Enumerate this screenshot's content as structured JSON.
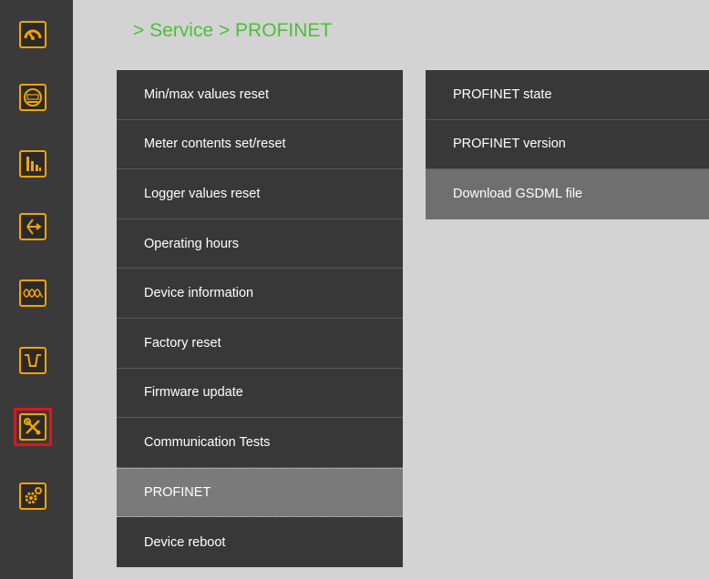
{
  "breadcrumb": "> Service > PROFINET",
  "sidebar": {
    "items": [
      {
        "icon": "gauge-icon",
        "selected": false
      },
      {
        "icon": "meter-display-icon",
        "selected": false
      },
      {
        "icon": "bar-chart-icon",
        "selected": false
      },
      {
        "icon": "phasor-icon",
        "selected": false
      },
      {
        "icon": "waveform-icon",
        "selected": false
      },
      {
        "icon": "pulse-dip-icon",
        "selected": false
      },
      {
        "icon": "tools-icon",
        "selected": true
      },
      {
        "icon": "settings-gear-icon",
        "selected": false
      }
    ],
    "accent_color": "#f5a400",
    "selected_color": "#e0141e"
  },
  "service_menu": {
    "items": [
      {
        "label": "Min/max values reset"
      },
      {
        "label": "Meter contents set/reset"
      },
      {
        "label": "Logger values reset"
      },
      {
        "label": "Operating hours"
      },
      {
        "label": "Device information"
      },
      {
        "label": "Factory reset"
      },
      {
        "label": "Firmware update"
      },
      {
        "label": "Communication Tests"
      },
      {
        "label": "PROFINET",
        "active": true
      },
      {
        "label": "Device reboot"
      }
    ]
  },
  "profinet_menu": {
    "items": [
      {
        "label": "PROFINET state"
      },
      {
        "label": "PROFINET version"
      },
      {
        "label": "Download GSDML file",
        "active": true
      }
    ]
  }
}
